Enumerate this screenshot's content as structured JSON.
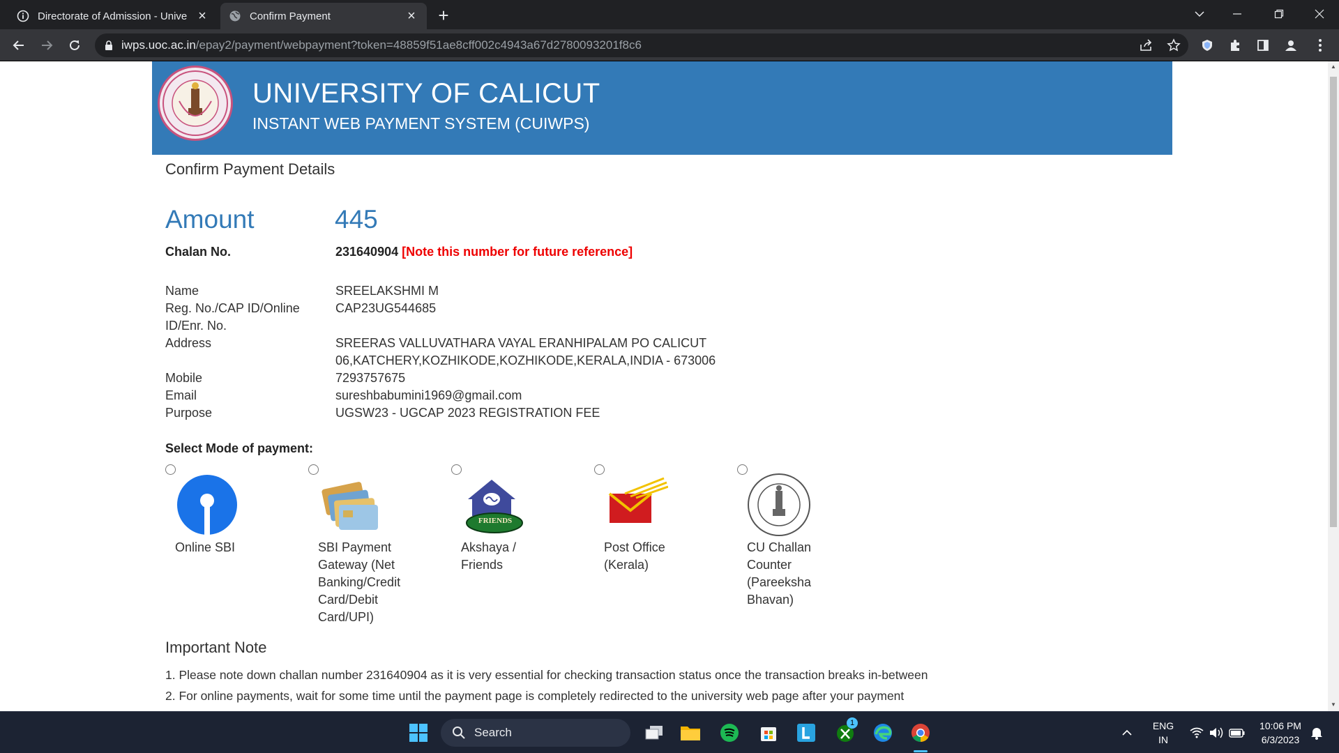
{
  "browser": {
    "tabs": [
      {
        "title": "Directorate of Admission - Unive",
        "active": false
      },
      {
        "title": "Confirm Payment",
        "active": true
      }
    ],
    "url_host": "iwps.uoc.ac.in",
    "url_path": "/epay2/payment/webpayment?token=48859f51ae8cff002c4943a67d2780093201f8c6"
  },
  "header": {
    "title": "UNIVERSITY OF CALICUT",
    "subtitle": "INSTANT WEB PAYMENT SYSTEM (CUIWPS)"
  },
  "page": {
    "heading": "Confirm Payment Details",
    "amount_label": "Amount",
    "amount_value": "445",
    "chalan_label": "Chalan No.",
    "chalan_value": "231640904",
    "chalan_note": "[Note this number for future reference]",
    "details": {
      "name_label": "Name",
      "name_value": "SREELAKSHMI M",
      "reg_label_1": "Reg. No./CAP ID/Online",
      "reg_label_2": "ID/Enr. No.",
      "reg_value": "CAP23UG544685",
      "address_label": "Address",
      "address_line1": "SREERAS VALLUVATHARA VAYAL ERANHIPALAM PO CALICUT",
      "address_line2": "06,KATCHERY,KOZHIKODE,KOZHIKODE,KERALA,INDIA - 673006",
      "mobile_label": "Mobile",
      "mobile_value": "7293757675",
      "email_label": "Email",
      "email_value": "sureshbabumini1969@gmail.com",
      "purpose_label": "Purpose",
      "purpose_value": "UGSW23 - UGCAP 2023 REGISTRATION FEE"
    },
    "payment_mode_label": "Select Mode of payment:",
    "payment_modes": [
      {
        "lines": [
          "Online SBI"
        ]
      },
      {
        "lines": [
          "SBI Payment",
          "Gateway (Net",
          "Banking/Credit",
          "Card/Debit",
          "Card/UPI)"
        ]
      },
      {
        "lines": [
          "Akshaya /",
          "Friends"
        ]
      },
      {
        "lines": [
          "Post Office",
          "(Kerala)"
        ]
      },
      {
        "lines": [
          "CU Challan",
          "Counter",
          "(Pareeksha",
          "Bhavan)"
        ]
      }
    ],
    "friends_logo_text": "FRIENDS",
    "note_heading": "Important Note",
    "notes": [
      "1. Please note down challan number 231640904 as it is very essential for checking transaction status once the transaction breaks in-between",
      "2. For online payments, wait for some time until the payment page is completely redirected to the university web page after your payment"
    ]
  },
  "taskbar": {
    "search_label": "Search",
    "lang_top": "ENG",
    "lang_bottom": "IN",
    "time": "10:06 PM",
    "date": "6/3/2023",
    "badge": "1"
  }
}
